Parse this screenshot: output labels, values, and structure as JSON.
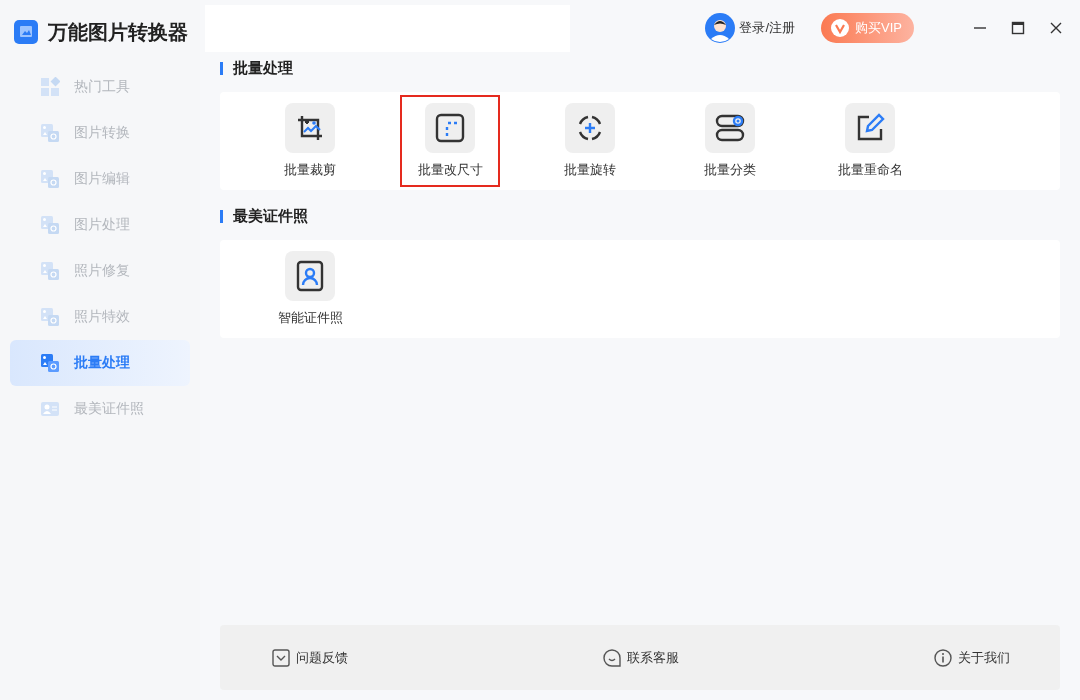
{
  "app": {
    "title": "万能图片转换器"
  },
  "sidebar": {
    "items": [
      {
        "label": "热门工具",
        "kind": "grid",
        "selected": false
      },
      {
        "label": "图片转换",
        "kind": "convert",
        "selected": false
      },
      {
        "label": "图片编辑",
        "kind": "edit",
        "selected": false
      },
      {
        "label": "图片处理",
        "kind": "process",
        "selected": false
      },
      {
        "label": "照片修复",
        "kind": "repair",
        "selected": false
      },
      {
        "label": "照片特效",
        "kind": "effect",
        "selected": false
      },
      {
        "label": "批量处理",
        "kind": "batch",
        "selected": true
      },
      {
        "label": "最美证件照",
        "kind": "idphoto",
        "selected": false
      }
    ]
  },
  "header": {
    "login": "登录/注册",
    "vip": "购买VIP"
  },
  "sections": [
    {
      "title": "批量处理",
      "tools": [
        {
          "label": "批量裁剪",
          "kind": "crop",
          "highlighted": false
        },
        {
          "label": "批量改尺寸",
          "kind": "resize",
          "highlighted": true
        },
        {
          "label": "批量旋转",
          "kind": "rotate",
          "highlighted": false
        },
        {
          "label": "批量分类",
          "kind": "classify",
          "highlighted": false
        },
        {
          "label": "批量重命名",
          "kind": "rename",
          "highlighted": false
        }
      ]
    },
    {
      "title": "最美证件照",
      "tools": [
        {
          "label": "智能证件照",
          "kind": "idphoto",
          "highlighted": false
        }
      ]
    }
  ],
  "footer": [
    {
      "label": "问题反馈",
      "kind": "feedback"
    },
    {
      "label": "联系客服",
      "kind": "service"
    },
    {
      "label": "关于我们",
      "kind": "about"
    }
  ]
}
